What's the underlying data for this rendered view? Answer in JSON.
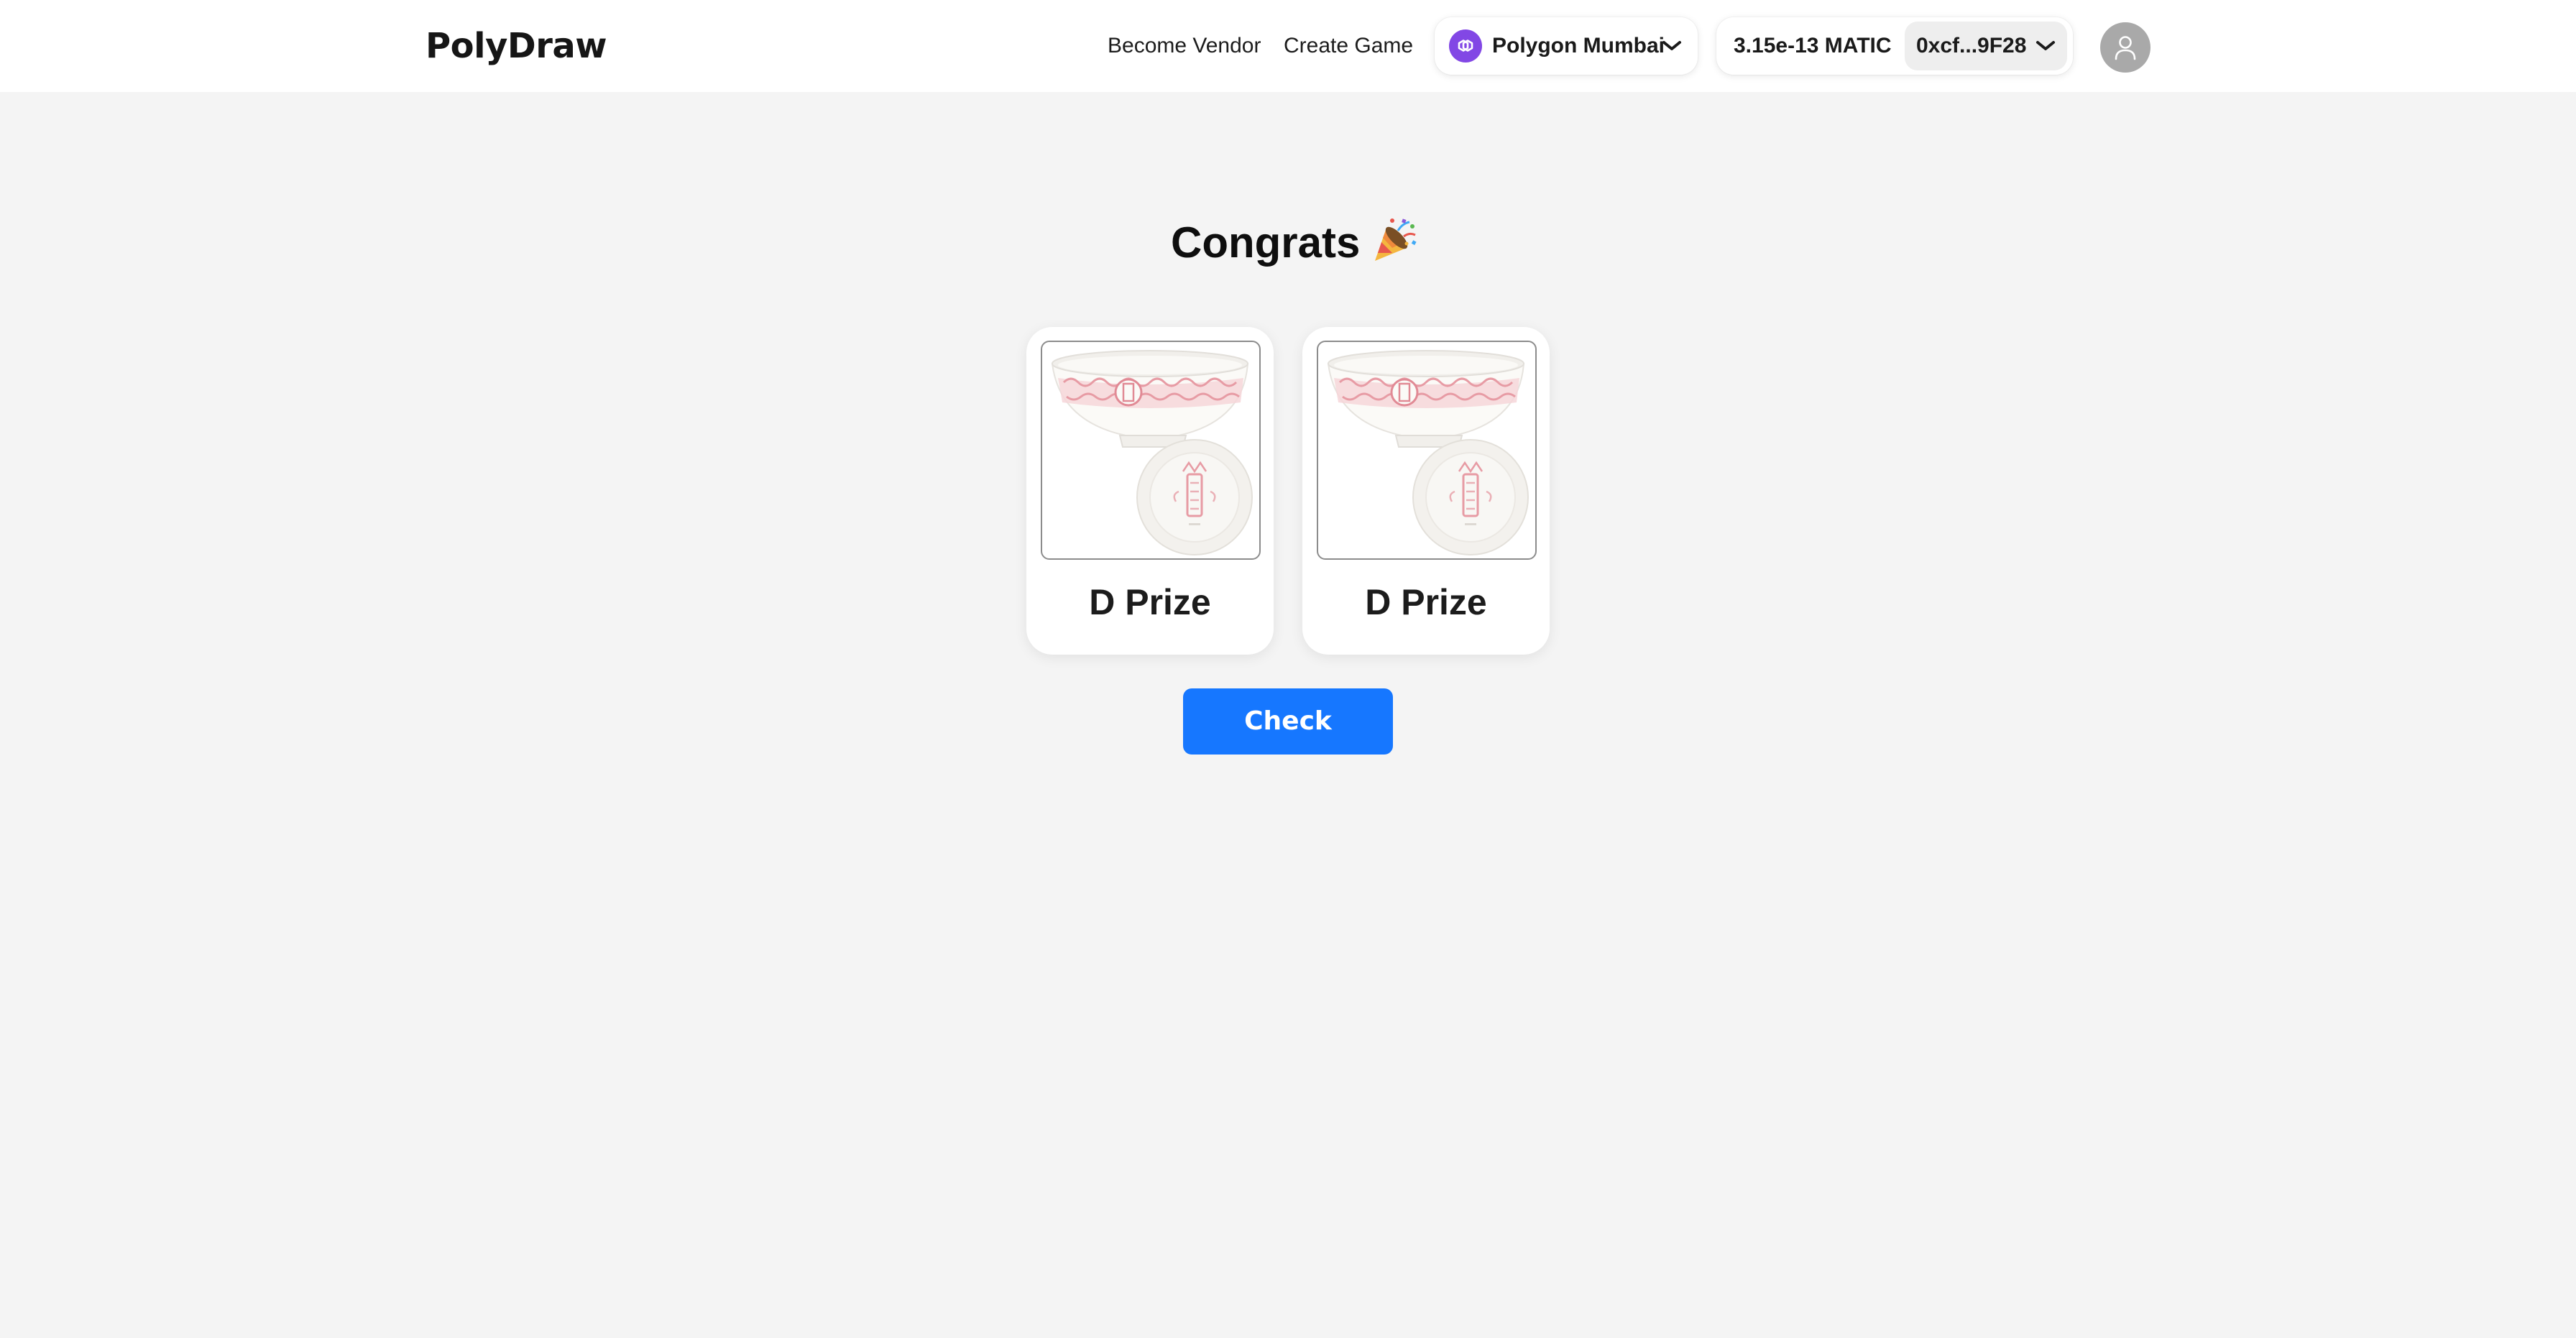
{
  "header": {
    "logo": "PolyDraw",
    "nav": {
      "become_vendor": "Become Vendor",
      "create_game": "Create Game"
    },
    "network": {
      "label": "Polygon Mumbai",
      "icon": "polygon-logo-icon",
      "icon_color": "#8247e5"
    },
    "wallet": {
      "balance": "3.15e-13 MATIC",
      "address": "0xcf...9F28"
    },
    "avatar_icon": "user-icon"
  },
  "main": {
    "title": "Congrats",
    "title_icon": "party-popper-icon",
    "prizes": [
      {
        "label": "D Prize",
        "image": "bowl-and-plate-image"
      },
      {
        "label": "D Prize",
        "image": "bowl-and-plate-image"
      }
    ],
    "check_button": "Check"
  },
  "colors": {
    "accent": "#1677ff",
    "background": "#f4f4f4"
  }
}
